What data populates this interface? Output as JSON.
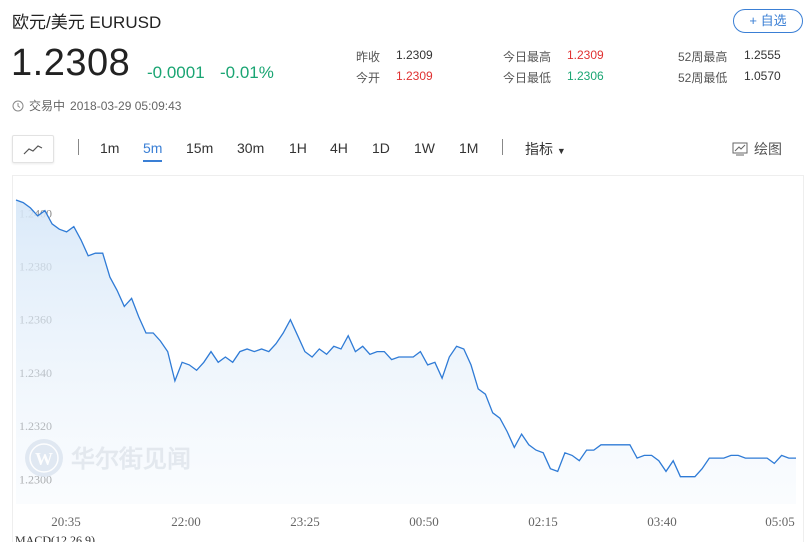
{
  "header": {
    "title": "欧元/美元  EURUSD",
    "add_button": "+ 自选",
    "price": "1.2308",
    "change": "-0.0001",
    "change_pct": "-0.01%",
    "status_label": "交易中",
    "timestamp": "2018-03-29 05:09:43"
  },
  "stats": [
    {
      "label": "昨收",
      "value": "1.2309",
      "color": "#333333"
    },
    {
      "label": "今开",
      "value": "1.2309",
      "color": "#e03131"
    },
    {
      "label": "今日最高",
      "value": "1.2309",
      "color": "#e03131"
    },
    {
      "label": "今日最低",
      "value": "1.2306",
      "color": "#1aa573"
    },
    {
      "label": "52周最高",
      "value": "1.2555",
      "color": "#333333"
    },
    {
      "label": "52周最低",
      "value": "1.0570",
      "color": "#333333"
    }
  ],
  "toolbar": {
    "timeframes": [
      "1m",
      "5m",
      "15m",
      "30m",
      "1H",
      "4H",
      "1D",
      "1W",
      "1M"
    ],
    "active_timeframe": "5m",
    "indicator_label": "指标",
    "draw_label": "绘图"
  },
  "colors": {
    "accent": "#3a7fd5",
    "down": "#1aa573",
    "up": "#e03131"
  },
  "chart_data": {
    "type": "area",
    "y_tick_labels": [
      "1.2300",
      "1.2320",
      "1.2340",
      "1.2360",
      "1.2380",
      "1.2400"
    ],
    "ylim": [
      1.2293,
      1.2414
    ],
    "x_tick_labels": [
      "20:35",
      "22:00",
      "23:25",
      "00:50",
      "02:15",
      "03:40",
      "05:05"
    ],
    "watermark": "华尔街见闻",
    "footer_label": "MACD(12,26,9)",
    "series": [
      {
        "values": [
          1.2405,
          1.2404,
          1.2402,
          1.2399,
          1.2401,
          1.2396,
          1.2394,
          1.2393,
          1.2395,
          1.239,
          1.2384,
          1.2385,
          1.2385,
          1.2376,
          1.2371,
          1.2365,
          1.2368,
          1.2361,
          1.2355,
          1.2355,
          1.2352,
          1.2348,
          1.2337,
          1.2344,
          1.2343,
          1.2341,
          1.2344,
          1.2348,
          1.2344,
          1.2346,
          1.2344,
          1.2348,
          1.2349,
          1.2348,
          1.2349,
          1.2348,
          1.2351,
          1.2355,
          1.236,
          1.2354,
          1.2348,
          1.2346,
          1.2349,
          1.2347,
          1.235,
          1.2349,
          1.2354,
          1.2348,
          1.235,
          1.2347,
          1.2348,
          1.2348,
          1.2345,
          1.2346,
          1.2346,
          1.2346,
          1.2348,
          1.2343,
          1.2344,
          1.2338,
          1.2346,
          1.235,
          1.2349,
          1.2343,
          1.2334,
          1.2332,
          1.2325,
          1.2323,
          1.2318,
          1.2312,
          1.2317,
          1.2313,
          1.2311,
          1.231,
          1.2304,
          1.2303,
          1.231,
          1.2309,
          1.2307,
          1.2311,
          1.2311,
          1.2313,
          1.2313,
          1.2313,
          1.2313,
          1.2313,
          1.2308,
          1.2309,
          1.2309,
          1.2307,
          1.2303,
          1.2307,
          1.2301,
          1.2301,
          1.2301,
          1.2304,
          1.2308,
          1.2308,
          1.2308,
          1.2309,
          1.2309,
          1.2308,
          1.2308,
          1.2308,
          1.2308,
          1.2306,
          1.2309,
          1.2308,
          1.2308
        ]
      }
    ]
  }
}
